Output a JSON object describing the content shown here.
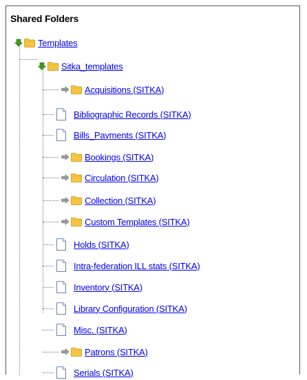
{
  "panel": {
    "title": "Shared Folders"
  },
  "tree": {
    "root": {
      "label": "Templates",
      "icon": "folder-icon",
      "expanded": true
    },
    "sub": {
      "label": "Sitka_templates",
      "icon": "folder-icon",
      "expanded": true
    },
    "items": [
      {
        "label": "Acquisitions (SITKA)",
        "type": "folder",
        "icon": "folder-icon"
      },
      {
        "label": "Bibliographic Records (SITKA)",
        "type": "file",
        "icon": "document-icon"
      },
      {
        "label": "Bills_Payments (SITKA)",
        "type": "file",
        "icon": "document-icon"
      },
      {
        "label": "Bookings (SITKA)",
        "type": "folder",
        "icon": "folder-icon"
      },
      {
        "label": "Circulation (SITKA)",
        "type": "folder",
        "icon": "folder-icon"
      },
      {
        "label": "Collection (SITKA)",
        "type": "folder",
        "icon": "folder-icon"
      },
      {
        "label": "Custom Templates (SITKA)",
        "type": "folder",
        "icon": "folder-icon"
      },
      {
        "label": "Holds (SITKA)",
        "type": "file",
        "icon": "document-icon"
      },
      {
        "label": "Intra-federation ILL stats (SITKA)",
        "type": "file",
        "icon": "document-icon"
      },
      {
        "label": "Inventory (SITKA)",
        "type": "file",
        "icon": "document-icon"
      },
      {
        "label": "Library Configuration (SITKA)",
        "type": "file",
        "icon": "document-icon"
      },
      {
        "label": "Misc. (SITKA)",
        "type": "file",
        "icon": "document-icon"
      },
      {
        "label": "Patrons (SITKA)",
        "type": "folder",
        "icon": "folder-icon"
      },
      {
        "label": "Serials (SITKA)",
        "type": "file",
        "icon": "document-icon"
      }
    ]
  },
  "colors": {
    "link": "#0000ee",
    "folder": "#f5c542",
    "expand_arrow": "#3a9a1a",
    "collapse_arrow": "#9a9a9a",
    "border": "#555555"
  }
}
